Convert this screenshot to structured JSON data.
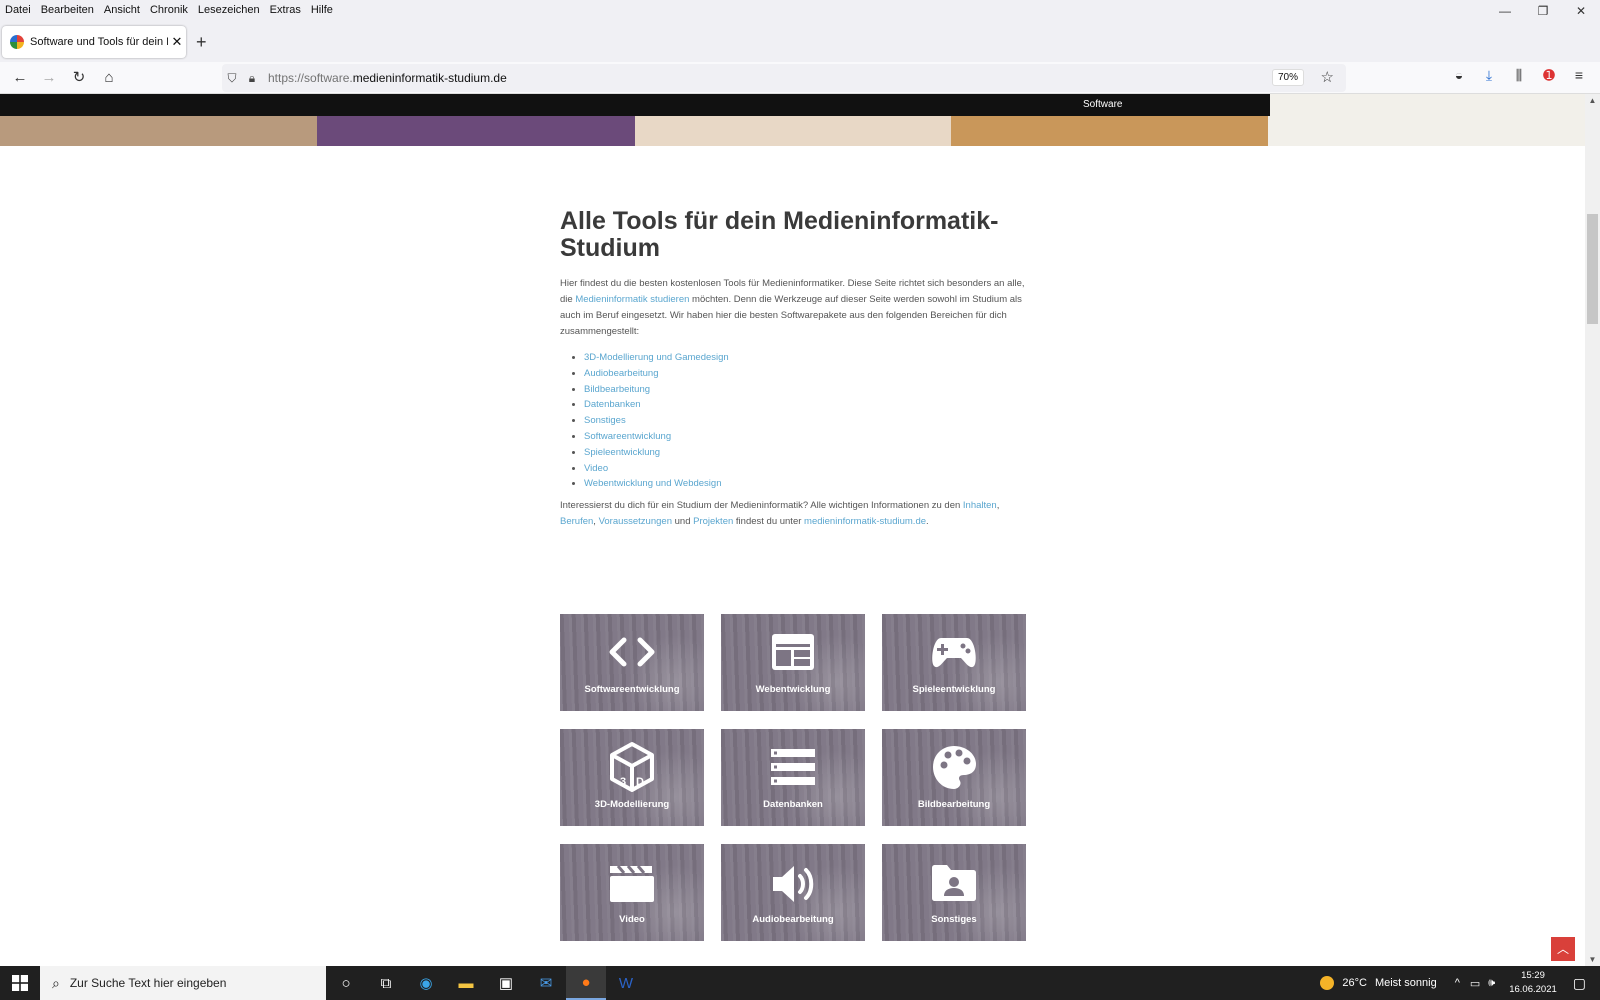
{
  "menubar": {
    "items": [
      "Datei",
      "Bearbeiten",
      "Ansicht",
      "Chronik",
      "Lesezeichen",
      "Extras",
      "Hilfe"
    ]
  },
  "tab": {
    "title": "Software und Tools für dein Medieninformatik-Studium",
    "close": "✕",
    "new": "+"
  },
  "urlbar": {
    "scheme": "https://software.",
    "host": "medieninformatik-studium.de",
    "zoom": "70%"
  },
  "banner": {
    "nav_label": "Software",
    "colors": [
      "#b89a7d",
      "#6b4a7a",
      "#e8d8c6",
      "#c9975a",
      "#f2f0ea"
    ]
  },
  "main": {
    "heading": "Alle Tools für dein Medieninformatik-Studium",
    "intro_1": "Hier findest du die besten kostenlosen Tools für Medieninformatiker. Diese Seite richtet sich besonders an alle, die ",
    "intro_link": "Medieninformatik studieren",
    "intro_2": " möchten. Denn die Werkzeuge auf dieser Seite werden sowohl im Studium als auch im Beruf eingesetzt. Wir haben hier die besten Softwarepakete aus den folgenden Bereichen für dich zusammengestellt:",
    "list": [
      "3D-Modellierung und Gamedesign",
      "Audiobearbeitung",
      "Bildbearbeitung",
      "Datenbanken",
      "Sonstiges",
      "Softwareentwicklung",
      "Spieleentwicklung",
      "Video",
      "Webentwicklung und Webdesign"
    ],
    "outro": {
      "t1": "Interessierst du dich für ein Studium der Medieninformatik? Alle wichtigen Informationen zu den ",
      "l1": "Inhalten",
      "s1": ", ",
      "l2": "Berufen",
      "s2": ", ",
      "l3": "Voraussetzungen",
      "t2": " und ",
      "l4": "Projekten",
      "t3": " findest du unter ",
      "l5": "medieninformatik-studium.de",
      "t4": "."
    }
  },
  "tiles": [
    {
      "label": "Softwareentwicklung",
      "icon": "code-icon"
    },
    {
      "label": "Webentwicklung",
      "icon": "browser-window-icon"
    },
    {
      "label": "Spieleentwicklung",
      "icon": "gamepad-icon"
    },
    {
      "label": "3D-Modellierung",
      "icon": "cube-3d-icon"
    },
    {
      "label": "Datenbanken",
      "icon": "database-list-icon"
    },
    {
      "label": "Bildbearbeitung",
      "icon": "palette-icon"
    },
    {
      "label": "Video",
      "icon": "clapperboard-icon"
    },
    {
      "label": "Audiobearbeitung",
      "icon": "speaker-icon"
    },
    {
      "label": "Sonstiges",
      "icon": "user-folder-icon"
    }
  ],
  "taskbar": {
    "search_placeholder": "Zur Suche Text hier eingeben",
    "weather_temp": "26°C",
    "weather_text": "Meist sonnig",
    "time": "15:29",
    "date": "16.06.2021"
  }
}
